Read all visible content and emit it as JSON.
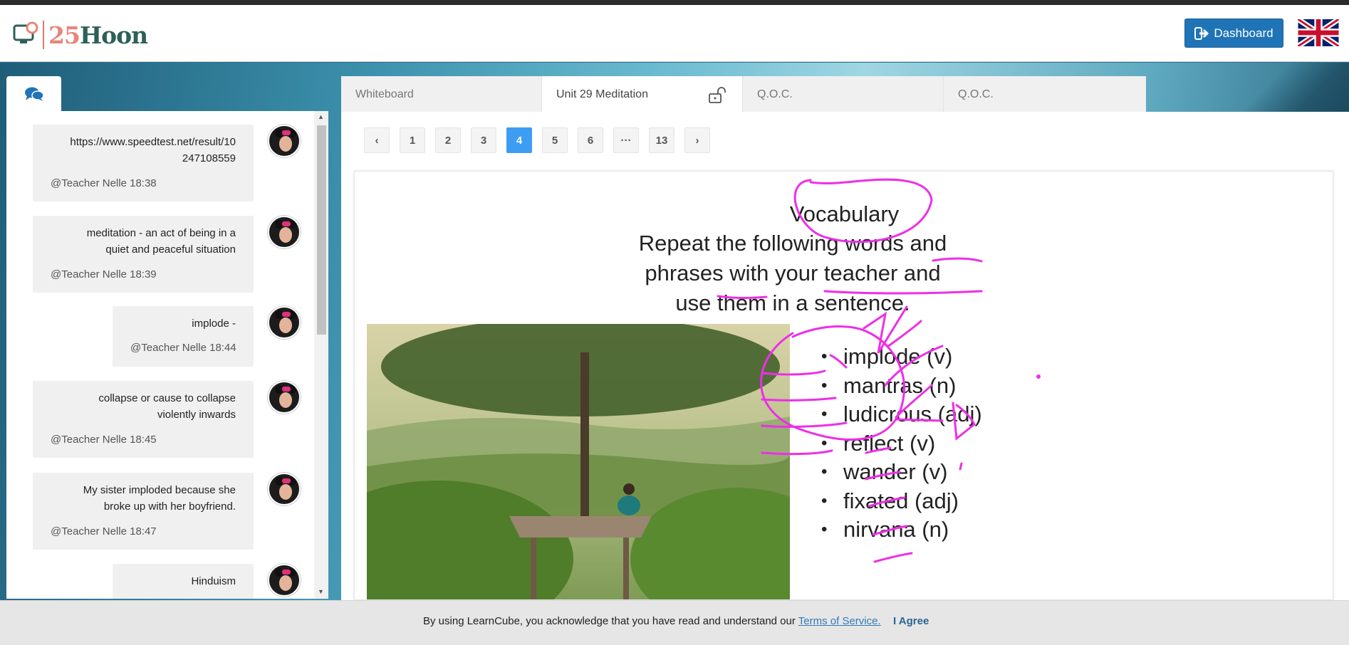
{
  "header": {
    "logo_number": "25",
    "logo_word": "Hoon",
    "dashboard_label": "Dashboard",
    "language_flag": "uk-flag-icon"
  },
  "chat": {
    "tab_icon": "chat-bubbles-icon",
    "messages": [
      {
        "lines": [
          "https://www.speedtest.net/result/10",
          "247108559"
        ],
        "meta": "@Teacher Nelle 18:38"
      },
      {
        "lines": [
          "meditation - an act of being in a",
          "quiet and peaceful situation"
        ],
        "meta": "@Teacher Nelle 18:39"
      },
      {
        "lines": [
          "implode -"
        ],
        "meta": "@Teacher Nelle 18:44"
      },
      {
        "lines": [
          "collapse or cause to collapse",
          "violently inwards"
        ],
        "meta": "@Teacher Nelle 18:45"
      },
      {
        "lines": [
          "My sister imploded because she",
          "broke up with her boyfriend."
        ],
        "meta": "@Teacher Nelle 18:47"
      },
      {
        "lines": [
          "Hinduism"
        ],
        "meta": ""
      }
    ]
  },
  "tabs": [
    {
      "label": "Whiteboard",
      "active": false
    },
    {
      "label": "Unit 29 Meditation",
      "active": true,
      "icon": "unlock-icon"
    },
    {
      "label": "Q.O.C.",
      "active": false
    },
    {
      "label": "Q.O.C.",
      "active": false
    }
  ],
  "pager": {
    "prev": "‹",
    "pages": [
      "1",
      "2",
      "3",
      "4",
      "5",
      "6",
      "···",
      "13"
    ],
    "current": "4",
    "next": "›"
  },
  "slide": {
    "title": "Vocabulary",
    "subtitle": "Repeat the following words and phrases with your teacher and use them in a sentence.",
    "vocab": [
      "implode (v)",
      "mantras (n)",
      "ludicrous (adj)",
      "reflect (v)",
      "wander (v)",
      "fixated (adj)",
      "nirvana (n)"
    ],
    "annotation_color": "#ee2ee8"
  },
  "cookie": {
    "text": "By using LearnCube, you acknowledge that you have read and understand our",
    "terms_link": "Terms of Service.",
    "agree": "I Agree"
  },
  "colors": {
    "primary": "#1f74b7",
    "active_page": "#3d9df3",
    "logo_number": "#e8857a",
    "logo_word": "#2e5f5a"
  }
}
